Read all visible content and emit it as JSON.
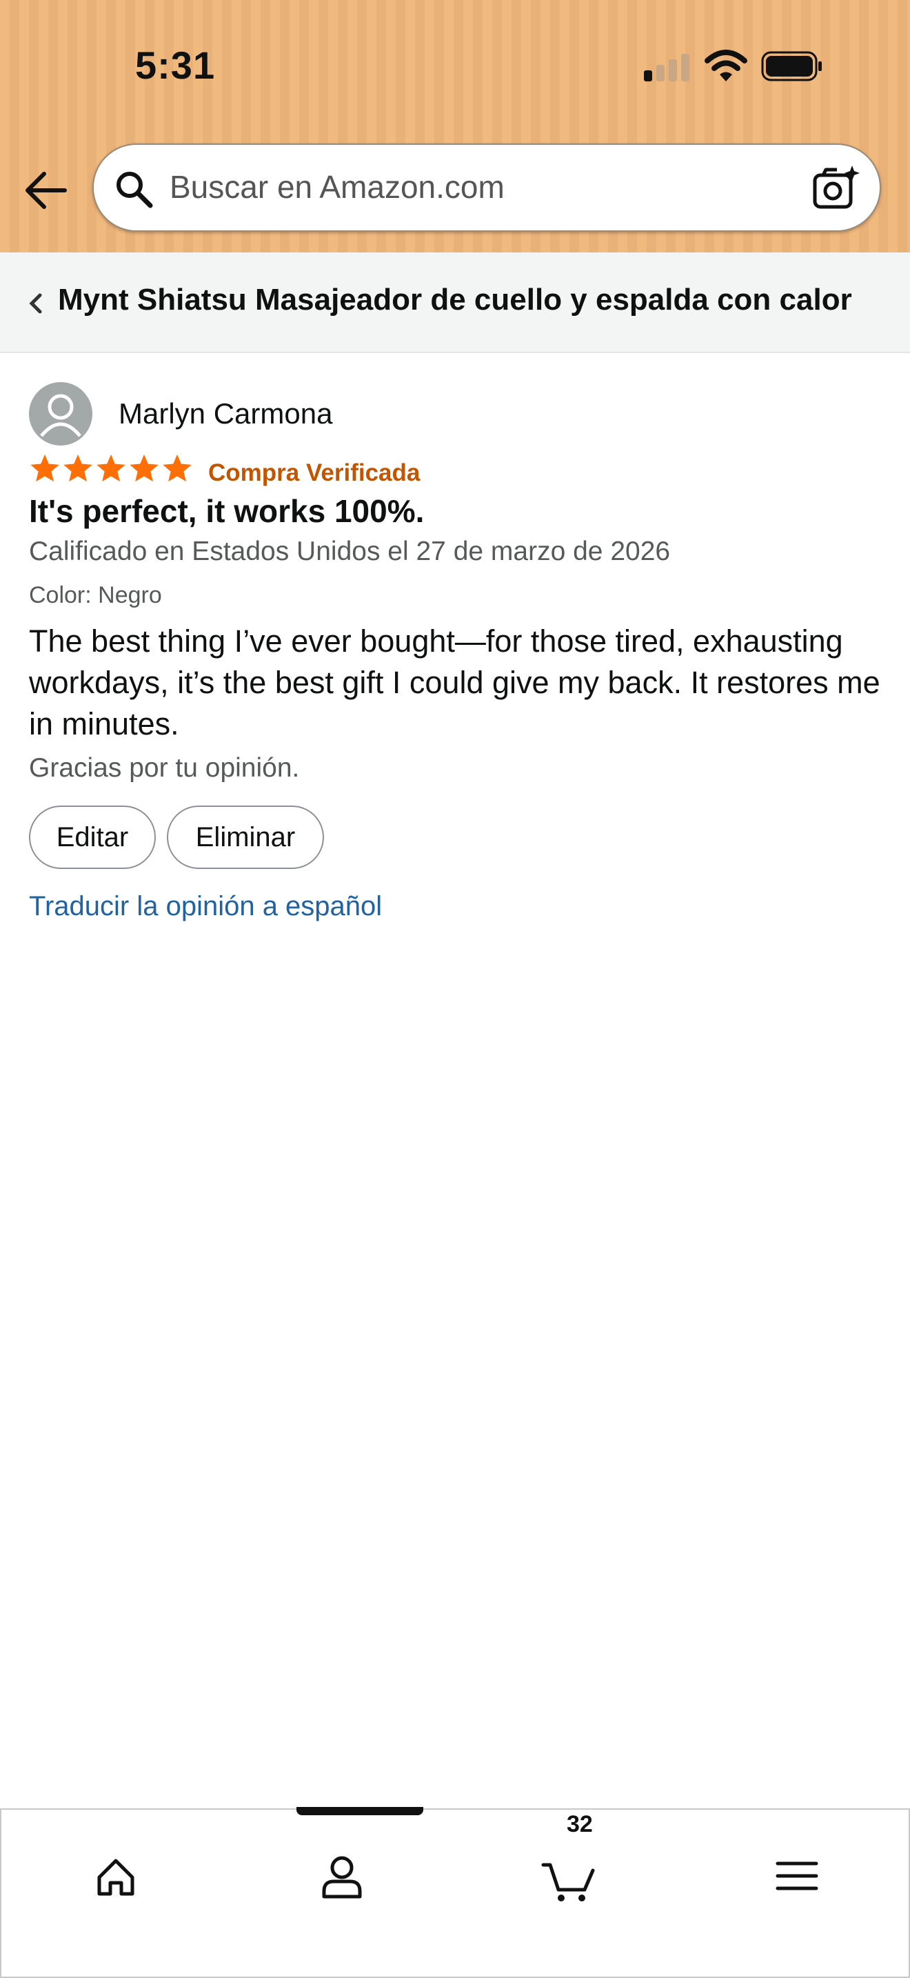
{
  "status_bar": {
    "time": "5:31"
  },
  "search": {
    "placeholder": "Buscar en Amazon.com"
  },
  "breadcrumb": {
    "title": "Mynt Shiatsu Masajeador de cuello y espalda con calor"
  },
  "review": {
    "reviewer": "Marlyn Carmona",
    "rating": 5,
    "rating_max": 5,
    "verified": "Compra Verificada",
    "title": "It's perfect, it works 100%.",
    "date": "Calificado en Estados Unidos el 27 de marzo de 2026",
    "variant": "Color: Negro",
    "body": "The best thing I’ve ever bought—for those tired, exhausting workdays, it’s the best gift I could give my back. It restores me in minutes.",
    "thanks": "Gracias por tu opinión.",
    "edit_label": "Editar",
    "delete_label": "Eliminar",
    "translate_link": "Traducir la opinión a español"
  },
  "bottom_nav": {
    "items": [
      "home-icon",
      "account-icon",
      "cart-icon",
      "menu-icon"
    ],
    "cart_count": "32"
  },
  "colors": {
    "header_bg": "#f0b97e",
    "star": "#ff6f06",
    "verified": "#c45500",
    "link": "#2162a1"
  }
}
